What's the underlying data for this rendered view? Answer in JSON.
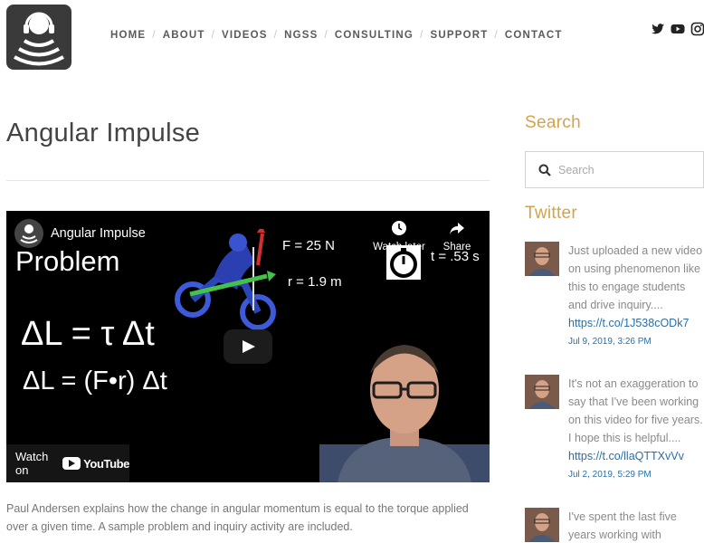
{
  "nav": {
    "items": [
      "HOME",
      "ABOUT",
      "VIDEOS",
      "NGSS",
      "CONSULTING",
      "SUPPORT",
      "CONTACT"
    ],
    "separator": "/"
  },
  "social": [
    "twitter-icon",
    "youtube-icon",
    "instagram-icon"
  ],
  "page": {
    "title": "Angular Impulse",
    "description": "Paul Andersen explains how the change in angular momentum is equal to the torque applied over a given time. A sample problem and inquiry activity are included."
  },
  "video": {
    "title": "Angular Impulse",
    "watch_later": "Watch later",
    "share": "Share",
    "watch_on": "Watch on",
    "youtube": "YouTube",
    "overlay": {
      "problem": "Problem",
      "force": "F = 25 N",
      "radius": "r = 1.9 m",
      "time": "t = .53 s",
      "eq1": "ΔL = τ Δt",
      "eq2": "ΔL = (F•r) Δt"
    }
  },
  "sidebar": {
    "search_heading": "Search",
    "search_placeholder": "Search",
    "twitter_heading": "Twitter",
    "tweets": [
      {
        "text": "Just uploaded a new video on using phenomenon like this to engage students and drive inquiry....",
        "link": "https://t.co/1J538cODk7",
        "date": "Jul 9, 2019, 3:26 PM"
      },
      {
        "text": "It's not an exaggeration to say that I've been working on this video for five years. I hope this is helpful....",
        "link": "https://t.co/llaQTTXvVv",
        "date": "Jul 2, 2019, 5:29 PM"
      },
      {
        "text": "I've spent the last five years working with",
        "link": "",
        "date": ""
      }
    ]
  },
  "colors": {
    "accent": "#d4a24a",
    "link": "#2a6fa8",
    "nav_text": "#5a5a5a"
  }
}
